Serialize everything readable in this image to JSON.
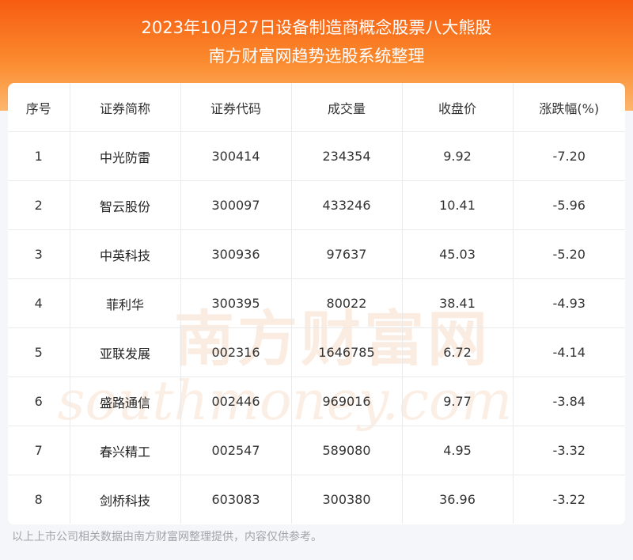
{
  "header": {
    "title_line1": "2023年10月27日设备制造商概念股票八大熊股",
    "title_line2": "南方财富网趋势选股系统整理"
  },
  "table": {
    "columns": [
      "序号",
      "证券简称",
      "证券代码",
      "成交量",
      "收盘价",
      "涨跌幅(%)"
    ],
    "rows": [
      [
        "1",
        "中光防雷",
        "300414",
        "234354",
        "9.92",
        "-7.20"
      ],
      [
        "2",
        "智云股份",
        "300097",
        "433246",
        "10.41",
        "-5.96"
      ],
      [
        "3",
        "中英科技",
        "300936",
        "97637",
        "45.03",
        "-5.20"
      ],
      [
        "4",
        "菲利华",
        "300395",
        "80022",
        "38.41",
        "-4.93"
      ],
      [
        "5",
        "亚联发展",
        "002316",
        "1646785",
        "6.72",
        "-4.14"
      ],
      [
        "6",
        "盛路通信",
        "002446",
        "969016",
        "9.77",
        "-3.84"
      ],
      [
        "7",
        "春兴精工",
        "002547",
        "589080",
        "4.95",
        "-3.32"
      ],
      [
        "8",
        "剑桥科技",
        "603083",
        "300380",
        "36.96",
        "-3.22"
      ]
    ]
  },
  "watermark": {
    "cn": "南方财富网",
    "en": "southmoney.com"
  },
  "footer": {
    "note": "以上上市公司相关数据由南方财富网整理提供，内容仅供参考。"
  },
  "colors": {
    "header_top": "#f75c10",
    "header_bottom": "#fdb66c",
    "watermark": "#f3c9a8"
  }
}
